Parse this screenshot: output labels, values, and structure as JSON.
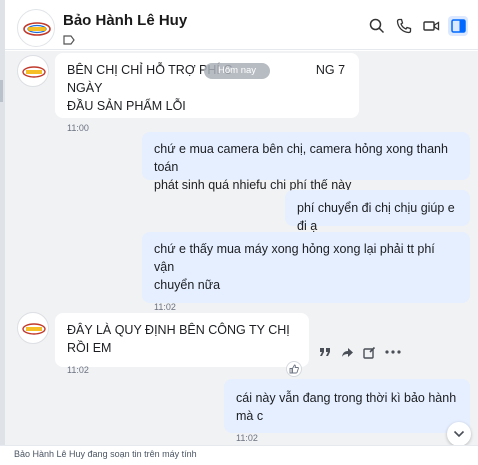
{
  "header": {
    "title": "Bảo Hành Lê Huy",
    "logo_text": "Camera"
  },
  "date_divider": "Hôm nay",
  "messages": [
    {
      "text": "BÊN CHỊ CHỈ HỖ TRỢ PHÍ C... NG 7 NGÀY ĐẦU SẢN PHẨM LỖI",
      "line1": "BÊN CHỊ CHỈ HỖ TRỢ PHÍ C",
      "line1b": "NG 7 NGÀY",
      "line2": "ĐẦU SẢN PHẨM LỖI",
      "time": "11:00"
    },
    {
      "text": "chứ e mua camera bên chị, camera hỏng xong thanh toán phát sinh quá nhiều chi phí thế này",
      "line1": "chứ e mua camera bên chị, camera hỏng xong thanh toán",
      "line2": "phát sinh quá nhiefu chi phí thế này"
    },
    {
      "text": "phí chuyển đi chị chịu giúp e đi ạ"
    },
    {
      "line1": "chứ e thấy mua máy xong hỏng xong lại phải tt phí vận",
      "line2": "chuyển nữa",
      "time": "11:02"
    },
    {
      "text": "ĐÂY LÀ QUY ĐỊNH BÊN CÔNG TY CHỊ RỒI EM",
      "time": "11:02"
    },
    {
      "text": "cái này vẫn đang trong thời kì bảo hành mà c",
      "time": "11:02"
    }
  ],
  "status": {
    "typing": "Bảo Hành Lê Huy đang soạn tin trên máy tính"
  },
  "colors": {
    "chat_bg": "#f1f2f4",
    "incoming_bubble": "#ffffff",
    "outgoing_bubble": "#e5efff",
    "accent": "#0068ff"
  },
  "icons": [
    "search-icon",
    "phone-icon",
    "video-icon",
    "sidebar-toggle-icon",
    "quote-icon",
    "forward-icon",
    "edit-icon",
    "more-icon",
    "like-icon",
    "chevron-down-icon",
    "tag-icon"
  ]
}
